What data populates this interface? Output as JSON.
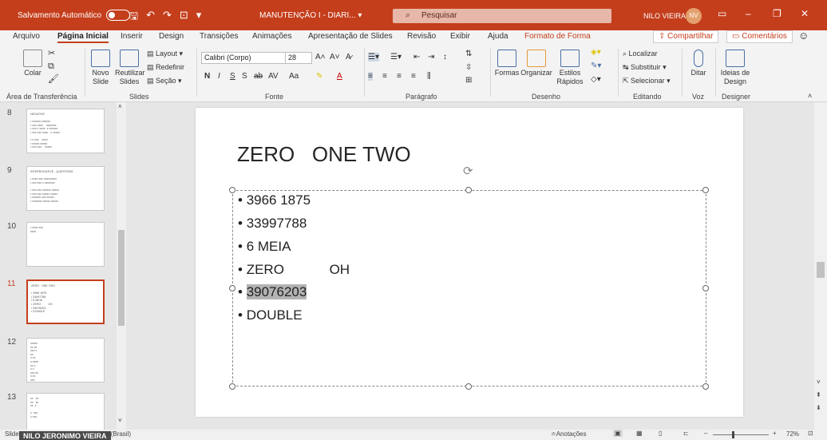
{
  "titlebar": {
    "autosave": "Salvamento Automático",
    "doc_title": "MANUTENÇÃO I - DIARI... ▾",
    "search_placeholder": "Pesquisar",
    "user_name": "NILO VIEIRA",
    "user_initials": "NV"
  },
  "tabs": [
    "Arquivo",
    "Página Inicial",
    "Inserir",
    "Design",
    "Transições",
    "Animações",
    "Apresentação de Slides",
    "Revisão",
    "Exibir",
    "Ajuda",
    "Formato de Forma"
  ],
  "share": "Compartilhar",
  "comments": "Comentários",
  "ribbon": {
    "clipboard": {
      "paste": "Colar",
      "label": "Área de Transferência"
    },
    "slides": {
      "new": "Novo Slide",
      "reuse": "Reutilizar Slides",
      "layout": "Layout",
      "reset": "Redefinir",
      "section": "Seção",
      "label": "Slides"
    },
    "font": {
      "name": "Calibri (Corpo)",
      "size": "28",
      "label": "Fonte"
    },
    "paragraph": {
      "label": "Parágrafo"
    },
    "drawing": {
      "shapes": "Formas",
      "arrange": "Organizar",
      "styles": "Estilos Rápidos",
      "label": "Desenho"
    },
    "editing": {
      "find": "Localizar",
      "replace": "Substituir",
      "select": "Selecionar",
      "label": "Editando"
    },
    "voice": {
      "dictate": "Ditar",
      "label": "Voz"
    },
    "designer": {
      "ideas": "Ideias de Design",
      "label": "Designer"
    }
  },
  "slides_panel": [
    {
      "num": "8",
      "lines": [
        "NEGATIVE",
        "",
        "• xxxxxx xxxxxx",
        "• xxx xxxx    xxxxxxx",
        "• xxx x xxxx  x xxxxxx",
        "• xxx xxx xxxx   x xxxxx",
        "",
        "• x xxx    xxxx",
        "• xxxxx xxxxx",
        "• xxx xxx    xxxxx"
      ]
    },
    {
      "num": "9",
      "lines": [
        "INTERROGATIVE - QUESTIONS",
        "",
        "• xxxx xxx xxxxxxxxx",
        "• xxx xxx x xxxxxxx",
        "",
        "• xxx xxx xxxxxx xxxxx",
        "• xxx xxx xxxxx xxxxx",
        "• xxxxxx xxx xxxxx",
        "• xxxxxxx xxxxx xxxxx"
      ]
    },
    {
      "num": "10",
      "lines": [
        "• xxxx xxx",
        "xxxx"
      ]
    },
    {
      "num": "11",
      "lines": [
        "ZERO   ONE TWO",
        "",
        "• 3966 1875",
        "• 33997788",
        "• 6 MEIA",
        "• ZERO         OH",
        "• 39076203",
        "• DOUBLE"
      ]
    },
    {
      "num": "12",
      "lines": [
        "xxxxx",
        "xx xx",
        "xxx x",
        "xx",
        "x xx",
        "x xxxx",
        "xx x",
        "x x",
        "xxx xx",
        "x xx",
        "xxx"
      ]
    },
    {
      "num": "13",
      "lines": [
        "xx   xx",
        "xx   xx",
        "xx  x",
        "",
        "x  xxx",
        "x xxx"
      ]
    }
  ],
  "slide": {
    "title": "ZERO   ONE TWO",
    "bullets": [
      "3966 1875",
      "33997788",
      "6 MEIA",
      "ZERO            OH",
      "39076203",
      "DOUBLE"
    ]
  },
  "status": {
    "slide_info": "Slide 11 de 18",
    "language": "Português (Brasil)",
    "notes": "Anotações",
    "zoom": "72%",
    "nameplate": "NILO JERONIMO VIEIRA"
  },
  "colors": {
    "accent": "#c43e1c",
    "selection": "#b3b3b3"
  }
}
